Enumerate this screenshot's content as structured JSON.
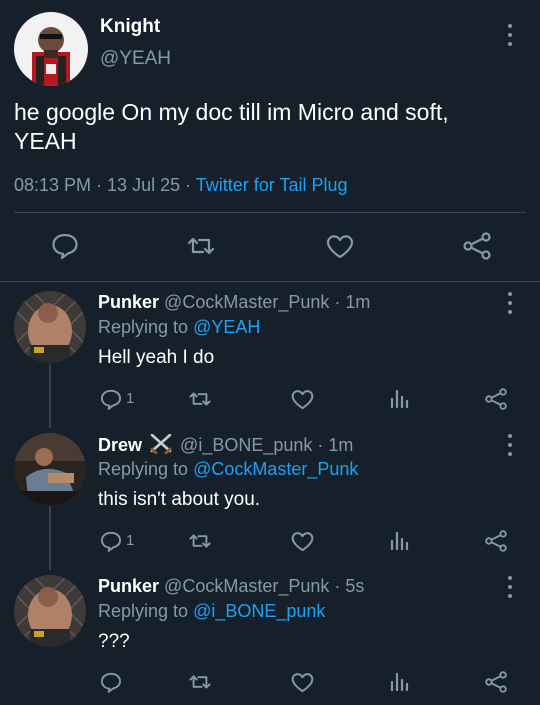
{
  "main_tweet": {
    "display_name": "Knight",
    "handle": "@YEAH",
    "text_line1": "he google On my doc till im Micro and soft,",
    "text_line2": "YEAH",
    "time": "08:13 PM · 13 Jul 25 ·",
    "source": "Twitter for Tail Plug"
  },
  "replies": [
    {
      "display_name": "Punker",
      "handle": "@CockMaster_Punk · 1m",
      "replying_label": "Replying to",
      "replying_to": "@YEAH",
      "text": "Hell yeah I do",
      "reply_count": "1"
    },
    {
      "display_name": "Drew",
      "name_emoji": "⚔️",
      "handle": "@i_BONE_punk · 1m",
      "replying_label": "Replying to",
      "replying_to": "@CockMaster_Punk",
      "text": "this isn't about you.",
      "reply_count": "1"
    },
    {
      "display_name": "Punker",
      "handle": "@CockMaster_Punk · 5s",
      "replying_label": "Replying to",
      "replying_to": "@i_BONE_punk",
      "text": "???",
      "reply_count": ""
    }
  ],
  "icons": [
    "reply-icon",
    "retweet-icon",
    "like-icon",
    "share-icon",
    "analytics-icon",
    "more-icon"
  ],
  "colors": {
    "background": "#15202b",
    "muted": "#8899a6",
    "link": "#1da1f2",
    "divider": "#38444d"
  }
}
